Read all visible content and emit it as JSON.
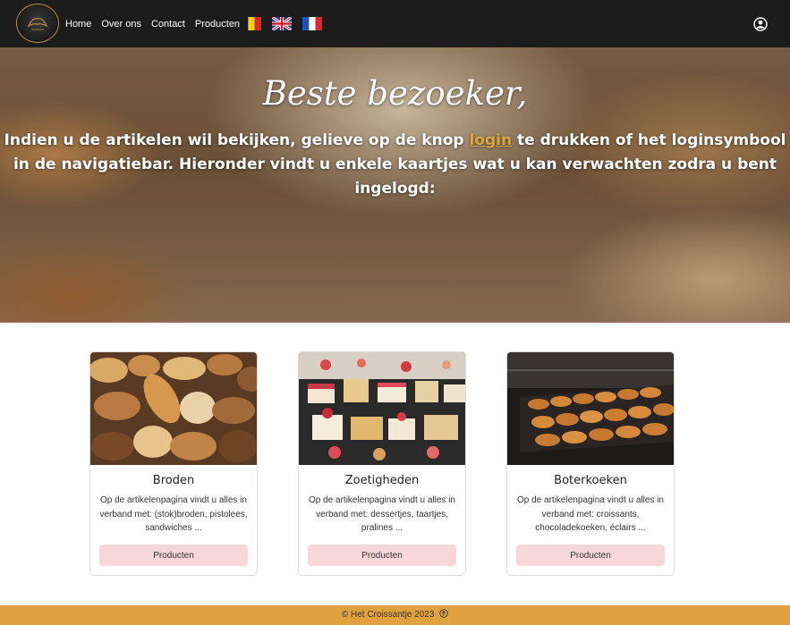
{
  "navbar": {
    "links": [
      "Home",
      "Over ons",
      "Contact",
      "Producten"
    ],
    "flags": [
      "belgium-flag-icon",
      "uk-flag-icon",
      "france-flag-icon"
    ],
    "user_icon": "user-circle-icon"
  },
  "hero": {
    "title": "Beste bezoeker,",
    "text_before": "Indien u de artikelen wil bekijken, gelieve op de knop ",
    "login_link": "login",
    "text_after": " te drukken of het loginsymbool in de navigatiebar. Hieronder vindt u enkele kaartjes wat u kan verwachten zodra u bent ingelogd:"
  },
  "cards": [
    {
      "title": "Broden",
      "text": "Op de artikelenpagina vindt u alles in verband met: (stok)broden, pistolees, sandwiches ...",
      "button": "Producten"
    },
    {
      "title": "Zoetigheden",
      "text": "Op de artikelenpagina vindt u alles in verband met: dessertjes, taartjes, pralines ...",
      "button": "Producten"
    },
    {
      "title": "Boterkoeken",
      "text": "Op de artikelenpagina vindt u alles in verband met: croissants, chocoladekoeken, éclairs ...",
      "button": "Producten"
    }
  ],
  "footer": {
    "text": "© Het Croissantje 2023",
    "icon": "arrow-up-circle-icon"
  },
  "colors": {
    "navbar_bg": "#1c1c1c",
    "footer_bg": "#e0a13f",
    "button_bg": "#f7d7da",
    "link_accent": "#d9a441"
  }
}
